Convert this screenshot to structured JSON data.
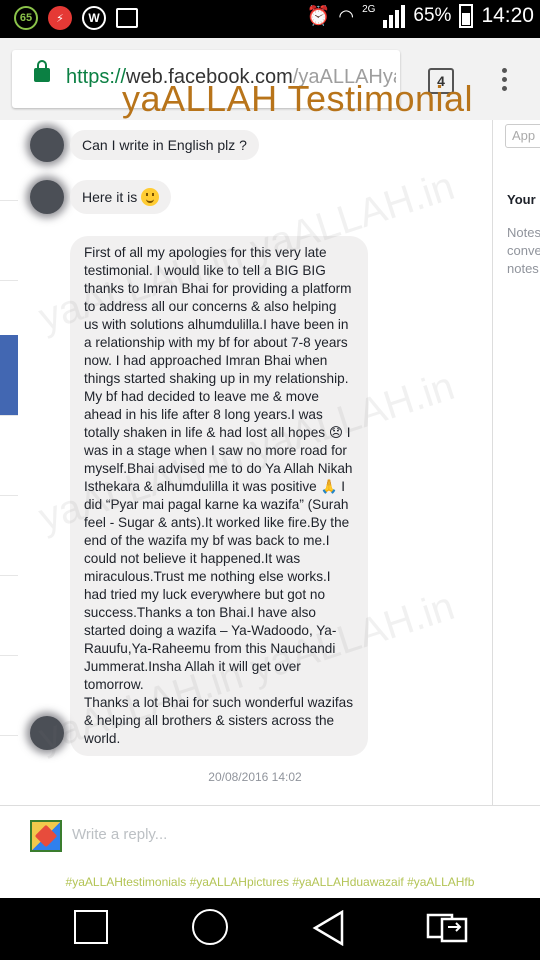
{
  "status_bar": {
    "badge_number": "65",
    "network": "2G",
    "battery": "65%",
    "time": "14:20"
  },
  "browser": {
    "url_scheme": "https://",
    "url_host": "web.facebook.com",
    "url_path": "/yaALLAHya",
    "tab_count": "4"
  },
  "overlay_title": "yaALLAH Testimonial",
  "right_panel": {
    "input_placeholder": "App",
    "heading": "Your r",
    "notes_lines": [
      "Notes",
      "conve",
      "notes"
    ]
  },
  "messages": [
    {
      "text": "Can I write in English plz ?"
    },
    {
      "text": "Here it is",
      "emoji": "slightly-smiling-face"
    },
    {
      "text": "First of all my apologies for this very late testimonial. I would like to tell a BIG BIG thanks to Imran Bhai for providing a platform to address all our concerns & also helping us with solutions alhumdulilla.I have been in a relationship with my bf for about 7-8 years now. I had approached Imran Bhai when things started shaking up in my relationship. My bf had decided to leave me & move ahead in his life after 8 long years.I was totally shaken in life & had lost all hopes 😞 I was in a stage when I saw no more road for myself.Bhai advised me to do Ya Allah Nikah Isthekara & alhumdulilla it was positive 🙏 I did “Pyar mai pagal karne ka wazifa” (Surah feel -  Sugar & ants).It worked like fire.By the end of the wazifa my bf was back to me.I could not believe it happened.It was miraculous.Trust me nothing else works.I had tried my luck everywhere but got no success.Thanks a ton Bhai.I have also started doing a wazifa – Ya-Wadoodo, Ya-Rauufu,Ya-Raheemu from this Nauchandi Jummerat.Insha Allah it will get over tomorrow.\nThanks a lot Bhai for such wonderful wazifas & helping all brothers & sisters across the world."
    }
  ],
  "timestamp": "20/08/2016 14:02",
  "reply_placeholder": "Write a reply...",
  "hashtags": "#yaALLAHtestimonials #yaALLAHpictures #yaALLAHduawazaif #yaALLAHfb",
  "watermark_text": "yaALLAH.in"
}
